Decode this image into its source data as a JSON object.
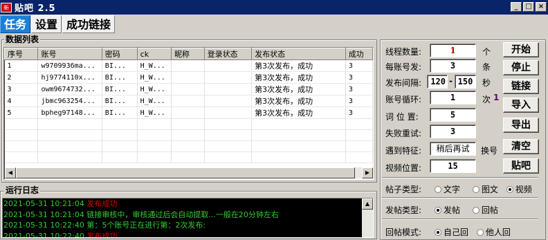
{
  "window": {
    "title": "贴吧 2.5",
    "icon_text": "新吧"
  },
  "tabs": [
    "任务",
    "设置",
    "成功链接"
  ],
  "data_list": {
    "label": "数据列表",
    "columns": [
      "序号",
      "账号",
      "密码",
      "ck",
      "昵称",
      "登录状态",
      "发布状态",
      "成功"
    ],
    "rows": [
      [
        "1",
        "w9709936ma...",
        "BI...",
        "H_W...",
        "",
        "",
        "第3次发布，成功",
        "3"
      ],
      [
        "2",
        "hj9774110x...",
        "BI...",
        "H_W...",
        "",
        "",
        "第3次发布，成功",
        "3"
      ],
      [
        "3",
        "owm9674732...",
        "BI...",
        "H_W...",
        "",
        "",
        "第3次发布，成功",
        "3"
      ],
      [
        "4",
        "jbmc963254...",
        "BI...",
        "H_W...",
        "",
        "",
        "第3次发布，成功",
        "3"
      ],
      [
        "5",
        "bpheg97148...",
        "BI...",
        "H_W...",
        "",
        "",
        "第3次发布，成功",
        "3"
      ]
    ]
  },
  "log": {
    "label": "运行日志",
    "lines": [
      {
        "time": "2021-05-31 10:21:04",
        "text": "发布成功",
        "color": "#e00000"
      },
      {
        "time": "2021-05-31 10:21:04",
        "text": "链接审核中，审核通过后会自动提取...一般在20分钟左右",
        "color": "#33cc33"
      },
      {
        "time": "2021-05-31 10:22:40",
        "text": "第：5个账号正在进行第：2次发布:",
        "color": "#33cc33"
      },
      {
        "time": "2021-05-31 10:22:40",
        "text": "发布成功",
        "color": "#e00000"
      }
    ]
  },
  "settings": {
    "thread_count": {
      "label": "线程数量:",
      "value": "1",
      "unit": "个"
    },
    "per_account": {
      "label": "每账号发:",
      "value": "3",
      "unit": "条"
    },
    "interval": {
      "label": "发布间隔:",
      "min": "120",
      "dash": "-",
      "max": "150",
      "unit": "秒"
    },
    "account_loop": {
      "label": "账号循环:",
      "value": "1",
      "unit": "次"
    },
    "word_position": {
      "label": "词 位 置:",
      "value": "5"
    },
    "fail_retry": {
      "label": "失败重试:",
      "value": "3"
    },
    "on_feature": {
      "label": "遇到特征:",
      "value": "稍后再试",
      "suffix": "换号"
    },
    "video_position": {
      "label": "视频位置:",
      "value": "15"
    },
    "post_type": {
      "label": "帖子类型:",
      "options": [
        "文字",
        "图文",
        "视频"
      ],
      "selected": "视频"
    },
    "send_type": {
      "label": "发帖类型:",
      "options": [
        "发帖",
        "回帖"
      ],
      "selected": "发帖"
    },
    "reply_mode": {
      "label": "回帖模式:",
      "options": [
        "自己回",
        "他人回"
      ],
      "selected": "自己回"
    }
  },
  "buttons": {
    "start": "开始",
    "stop": "停止",
    "link": "链接",
    "import": "导入",
    "export": "导出",
    "clear": "清空",
    "post": "贴吧"
  }
}
